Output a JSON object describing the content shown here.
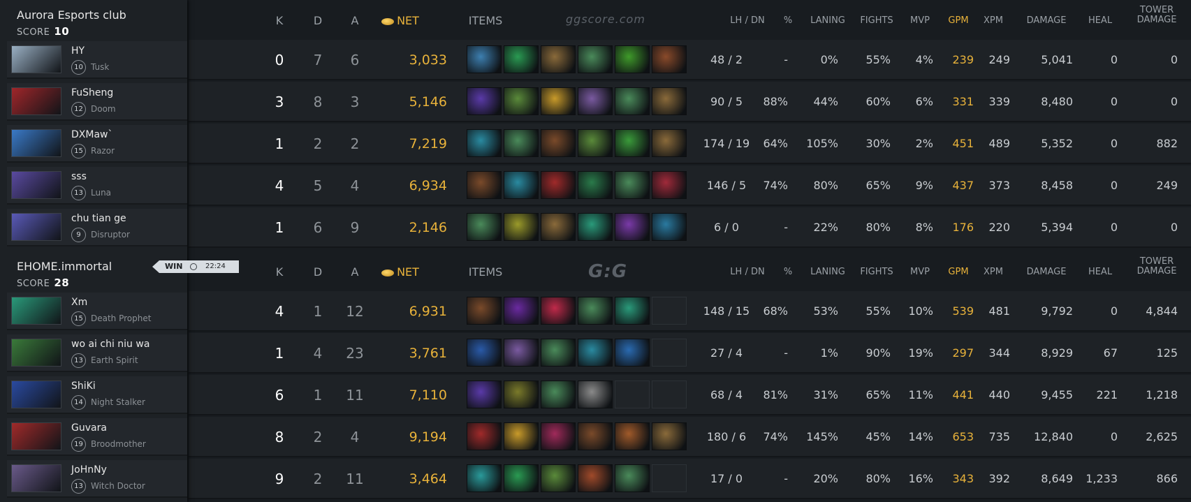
{
  "teams": [
    {
      "name": "Aurora Esports club",
      "score_label": "SCORE",
      "score": "10",
      "players": [
        {
          "name": "HY",
          "level": "10",
          "hero": "Tusk",
          "k": "0",
          "d": "7",
          "a": "6",
          "net": "3,033",
          "lhdn": "48 / 2",
          "pct": "-",
          "laning": "0%",
          "fights": "55%",
          "mvp": "4%",
          "gpm": "239",
          "xpm": "249",
          "damage": "5,041",
          "heal": "0",
          "tower": "0",
          "portrait": "#9ab0c4",
          "items": [
            "#3d7fb0",
            "#2a9a52",
            "#8a6a3a",
            "#4a8a5a",
            "#3f9a2a",
            "#8a4a2a"
          ]
        },
        {
          "name": "FuSheng",
          "level": "12",
          "hero": "Doom",
          "k": "3",
          "d": "8",
          "a": "3",
          "net": "5,146",
          "lhdn": "90 / 5",
          "pct": "88%",
          "laning": "44%",
          "fights": "60%",
          "mvp": "6%",
          "gpm": "331",
          "xpm": "339",
          "damage": "8,480",
          "heal": "0",
          "tower": "0",
          "portrait": "#a0262a",
          "items": [
            "#5a3aa8",
            "#5a8a3a",
            "#c89a2a",
            "#7a5aa0",
            "#4a8a5a",
            "#8a6a3a"
          ]
        },
        {
          "name": "DXMaw`",
          "level": "15",
          "hero": "Razor",
          "k": "1",
          "d": "2",
          "a": "2",
          "net": "7,219",
          "lhdn": "174 / 19",
          "pct": "64%",
          "laning": "105%",
          "fights": "30%",
          "mvp": "2%",
          "gpm": "451",
          "xpm": "489",
          "damage": "5,352",
          "heal": "0",
          "tower": "882",
          "portrait": "#3a7ac8",
          "items": [
            "#2a8aa0",
            "#4a8a5a",
            "#7a4a2a",
            "#5a8a3a",
            "#3a9a3a",
            "#8a6a3a"
          ]
        },
        {
          "name": "sss",
          "level": "13",
          "hero": "Luna",
          "k": "4",
          "d": "5",
          "a": "4",
          "net": "6,934",
          "lhdn": "146 / 5",
          "pct": "74%",
          "laning": "80%",
          "fights": "65%",
          "mvp": "9%",
          "gpm": "437",
          "xpm": "373",
          "damage": "8,458",
          "heal": "0",
          "tower": "249",
          "portrait": "#5a4aa0",
          "items": [
            "#7a4a2a",
            "#2a8aa0",
            "#a02a2a",
            "#2a7a4a",
            "#4a8a5a",
            "#a02a3a"
          ]
        },
        {
          "name": "chu tian ge",
          "level": "9",
          "hero": "Disruptor",
          "k": "1",
          "d": "6",
          "a": "9",
          "net": "2,146",
          "lhdn": "6 / 0",
          "pct": "-",
          "laning": "22%",
          "fights": "80%",
          "mvp": "8%",
          "gpm": "176",
          "xpm": "220",
          "damage": "5,394",
          "heal": "0",
          "tower": "0",
          "portrait": "#5a5ab8",
          "items": [
            "#4a8a5a",
            "#9a9a2a",
            "#8a6a3a",
            "#2a9a7a",
            "#7a3aa8",
            "#2a7aa0"
          ]
        }
      ]
    },
    {
      "name": "EHOME.immortal",
      "score_label": "SCORE",
      "score": "28",
      "players": [
        {
          "name": "Xm",
          "level": "15",
          "hero": "Death Prophet",
          "k": "4",
          "d": "1",
          "a": "12",
          "net": "6,931",
          "lhdn": "148 / 15",
          "pct": "68%",
          "laning": "53%",
          "fights": "55%",
          "mvp": "10%",
          "gpm": "539",
          "xpm": "481",
          "damage": "9,792",
          "heal": "0",
          "tower": "4,844",
          "portrait": "#2a9a7a",
          "items": [
            "#7a4a2a",
            "#6a2aa0",
            "#c02a4a",
            "#4a8a5a",
            "#2a9a7a"
          ]
        },
        {
          "name": "wo ai chi niu wa",
          "level": "13",
          "hero": "Earth Spirit",
          "k": "1",
          "d": "4",
          "a": "23",
          "net": "3,761",
          "lhdn": "27 / 4",
          "pct": "-",
          "laning": "1%",
          "fights": "90%",
          "mvp": "19%",
          "gpm": "297",
          "xpm": "344",
          "damage": "8,929",
          "heal": "67",
          "tower": "125",
          "portrait": "#3a7a3a",
          "items": [
            "#2a5aa8",
            "#7a5aa0",
            "#4a8a5a",
            "#2a8aa0",
            "#2a6ab0"
          ]
        },
        {
          "name": "ShiKi",
          "level": "14",
          "hero": "Night Stalker",
          "k": "6",
          "d": "1",
          "a": "11",
          "net": "7,110",
          "lhdn": "68 / 4",
          "pct": "81%",
          "laning": "31%",
          "fights": "65%",
          "mvp": "11%",
          "gpm": "441",
          "xpm": "440",
          "damage": "9,455",
          "heal": "221",
          "tower": "1,218",
          "portrait": "#2a4aa0",
          "items": [
            "#5a3aa8",
            "#7a7a2a",
            "#4a8a5a",
            "#8a8a8a"
          ]
        },
        {
          "name": "Guvara",
          "level": "19",
          "hero": "Broodmother",
          "k": "8",
          "d": "2",
          "a": "4",
          "net": "9,194",
          "lhdn": "180 / 6",
          "pct": "74%",
          "laning": "145%",
          "fights": "45%",
          "mvp": "14%",
          "gpm": "653",
          "xpm": "735",
          "damage": "12,840",
          "heal": "0",
          "tower": "2,625",
          "portrait": "#a02a2a",
          "items": [
            "#a02a2a",
            "#c89a2a",
            "#a02a5a",
            "#7a4a2a",
            "#a05a2a",
            "#8a6a3a"
          ]
        },
        {
          "name": "JoHnNy",
          "level": "13",
          "hero": "Witch Doctor",
          "k": "9",
          "d": "2",
          "a": "11",
          "net": "3,464",
          "lhdn": "17 / 0",
          "pct": "-",
          "laning": "20%",
          "fights": "80%",
          "mvp": "16%",
          "gpm": "343",
          "xpm": "392",
          "damage": "8,649",
          "heal": "1,233",
          "tower": "866",
          "portrait": "#6a5a8a",
          "items": [
            "#2a9a9a",
            "#2a9a52",
            "#5a8a3a",
            "#a04a2a",
            "#4a8a5a"
          ]
        }
      ]
    }
  ],
  "columns": {
    "k": "K",
    "d": "D",
    "a": "A",
    "net": "NET",
    "items": "ITEMS",
    "lhdn": "LH  /  DN",
    "pct": "%",
    "laning": "LANING",
    "fights": "FIGHTS",
    "mvp": "MVP",
    "gpm": "GPM",
    "xpm": "XPM",
    "damage": "DAMAGE",
    "heal": "HEAL",
    "tower_1": "TOWER",
    "tower_2": "DAMAGE"
  },
  "watermark_1": "ggscore.com",
  "watermark_2": "G:G",
  "result": {
    "label": "WIN",
    "duration": "22:24"
  },
  "colors": {
    "gold": "#e8b23a",
    "accent_white": "#ffffff"
  }
}
